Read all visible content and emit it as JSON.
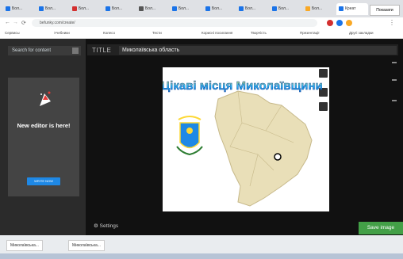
{
  "browser": {
    "tabs": [
      {
        "label": "Бол...",
        "color": "#1a73e8"
      },
      {
        "label": "Бол...",
        "color": "#1a73e8"
      },
      {
        "label": "Бол...",
        "color": "#d32f2f"
      },
      {
        "label": "Бол...",
        "color": "#1a73e8"
      },
      {
        "label": "Бол...",
        "color": "#555555"
      },
      {
        "label": "Бол...",
        "color": "#1a73e8"
      },
      {
        "label": "Бол...",
        "color": "#1a73e8"
      },
      {
        "label": "Бол...",
        "color": "#1a73e8"
      },
      {
        "label": "Бол...",
        "color": "#1a73e8"
      },
      {
        "label": "Бол...",
        "color": "#f9a825"
      },
      {
        "label": "Креат",
        "color": "#1a73e8",
        "active": true
      },
      {
        "label": "Бол...",
        "color": "#1a73e8"
      }
    ],
    "address": "befunky.com/create/",
    "bookmarks": [
      "Сервисы",
      "Учебники",
      "Колесо",
      "Тести",
      "Корисні посилання",
      "Творчість",
      "Презентації",
      "Другі закладки"
    ]
  },
  "left_panel": {
    "search_placeholder": "Search for content",
    "note": "",
    "promo": {
      "title": "New editor is here!",
      "text": "",
      "button": "WRITE NOW"
    },
    "bottom_text": ""
  },
  "editor": {
    "title_label": "TITLE",
    "title_value": "Миколаївська область",
    "canvas_heading": "Цікаві місця Миколаївщини",
    "settings_label": "Settings",
    "save_label": "Save image"
  },
  "taskbar": {
    "items": [
      "Миколаївська...",
      "Миколаївська..."
    ],
    "right_label": "Показати"
  },
  "colors": {
    "accent_blue": "#1e88e5",
    "save_green": "#43a047",
    "map_beige": "#e9dfb8"
  }
}
